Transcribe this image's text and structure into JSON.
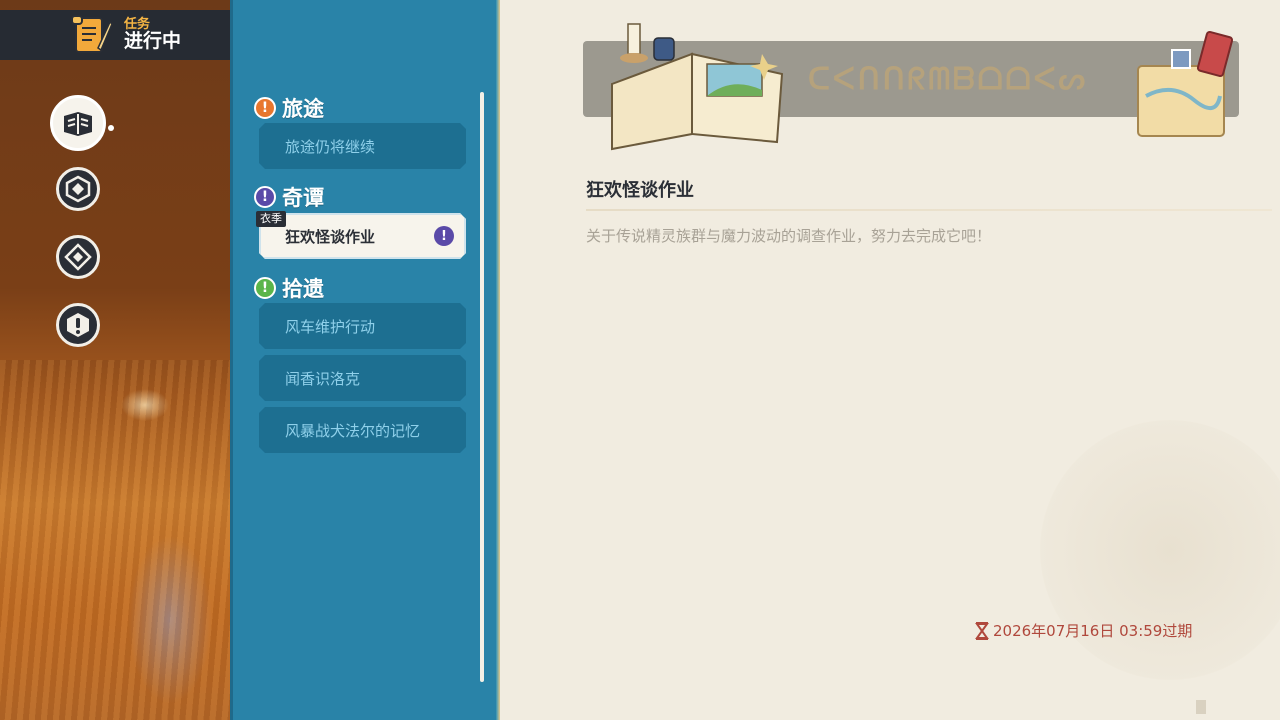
{
  "header": {
    "sub_label": "任务",
    "main_label": "进行中"
  },
  "nav_icons": [
    "quest-book-icon",
    "hexagon-diamond-icon",
    "hexagon-diamond-alt-icon",
    "exclamation-icon"
  ],
  "sections": [
    {
      "label": "旅途",
      "badge": "!",
      "color": "#e8772e",
      "items": [
        "旅途仍将继续"
      ]
    },
    {
      "label": "奇谭",
      "badge": "!",
      "color": "#5a4aa8",
      "items": [
        "狂欢怪谈作业"
      ]
    },
    {
      "label": "拾遗",
      "badge": "!",
      "color": "#5bb54a",
      "items": [
        "风车维护行动",
        "闻香识洛克",
        "风暴战犬法尔的记忆"
      ]
    }
  ],
  "season_tag": "衣季",
  "selected_badge": "!",
  "detail": {
    "banner_text": "ᑕᐸᑎᑎᖇᗰᗷᗝᗝᐸᔕ",
    "title": "狂欢怪谈作业",
    "description": "关于传说精灵族群与魔力波动的调查作业，努力去完成它吧！",
    "expire_text": "2026年07月16日 03:59过期"
  }
}
